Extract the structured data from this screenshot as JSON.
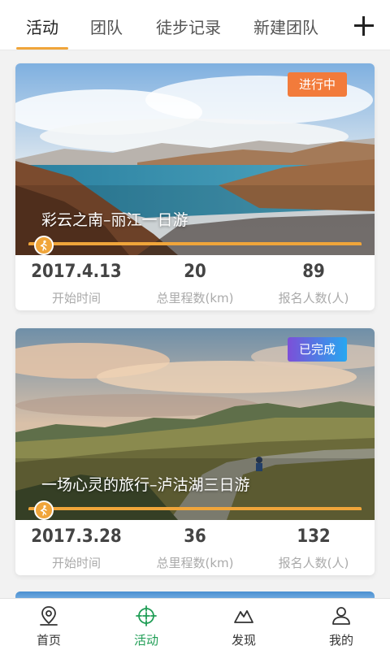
{
  "tabs": [
    {
      "label": "活动",
      "active": true
    },
    {
      "label": "团队",
      "active": false
    },
    {
      "label": "徒步记录",
      "active": false
    },
    {
      "label": "新建团队",
      "active": false
    }
  ],
  "add_icon": "plus-icon",
  "activities": [
    {
      "title": "彩云之南–丽江一日游",
      "status": "进行中",
      "status_color": "#f27b3b",
      "start_date": "2017.4.13",
      "start_label": "开始时间",
      "distance": "20",
      "distance_label": "总里程数(km)",
      "signups": "89",
      "signups_label": "报名人数(人)"
    },
    {
      "title": "一场心灵的旅行–泸沽湖三日游",
      "status": "已完成",
      "status_color": "#7c4fd8",
      "start_date": "2017.3.28",
      "start_label": "开始时间",
      "distance": "36",
      "distance_label": "总里程数(km)",
      "signups": "132",
      "signups_label": "报名人数(人)"
    }
  ],
  "bottom_nav": [
    {
      "label": "首页",
      "icon": "map-pin-icon",
      "active": false
    },
    {
      "label": "活动",
      "icon": "crosshair-icon",
      "active": true
    },
    {
      "label": "发现",
      "icon": "mountain-icon",
      "active": false
    },
    {
      "label": "我的",
      "icon": "user-icon",
      "active": false
    }
  ],
  "colors": {
    "accent": "#f0a53a",
    "active_nav": "#1f9d55"
  }
}
